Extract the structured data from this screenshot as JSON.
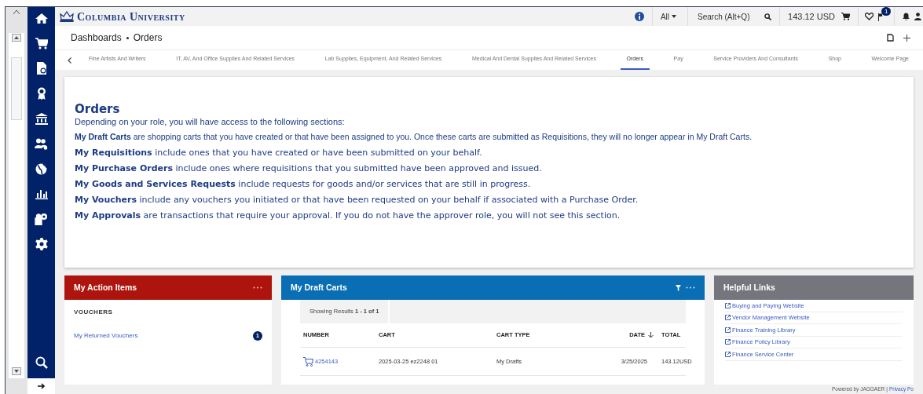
{
  "header": {
    "logo": "Columbia University",
    "scope": "All",
    "search_placeholder": "Search (Alt+Q)",
    "cart_total": "143.12 USD",
    "flag_count": "1"
  },
  "breadcrumb": [
    "Dashboards",
    "Orders"
  ],
  "tabs": [
    {
      "label": "Fine Artists And Writers",
      "selected": false
    },
    {
      "label": "IT, AV, And Office Supplies And Related Services",
      "selected": false
    },
    {
      "label": "Lab Supplies, Equipment, And Related Services",
      "selected": false
    },
    {
      "label": "Medical And Dental Supplies And Related Services",
      "selected": false
    },
    {
      "label": "Orders",
      "selected": true
    },
    {
      "label": "Pay",
      "selected": false
    },
    {
      "label": "Service Providers And Consultants",
      "selected": false
    },
    {
      "label": "Shop",
      "selected": false
    },
    {
      "label": "Welcome Page",
      "selected": false
    }
  ],
  "intro": {
    "title": "Orders",
    "subtitle": "Depending on your role, you will have access to the following sections:",
    "items": [
      "**My Draft Carts** are shopping carts that you have created or that have been assigned to you. Once these carts are submitted as Requisitions, they will no longer appear in My Draft Carts.",
      "**My Requisitions** include ones that you have created or have been submitted on your behalf.",
      "**My Purchase Orders** include ones where requisitions that you submitted have been approved and issued.",
      "**My Goods and Services Requests** include requests for goods and/or services that are still in progress.",
      "**My Vouchers** include any vouchers you initiated or that have been requested on your behalf if associated with a Purchase Order.",
      "**My Approvals** are transactions that require your approval. If you do not have the approver role, you will not see this section."
    ]
  },
  "action_items": {
    "title": "My Action Items",
    "section": "VOUCHERS",
    "items": [
      {
        "label": "My Returned Vouchers",
        "count": "1"
      }
    ]
  },
  "draft_carts": {
    "title": "My Draft Carts",
    "results": "Showing Results **1 - 1 of 1**",
    "columns": [
      {
        "label": "NUMBER",
        "sorted": false
      },
      {
        "label": "CART",
        "sorted": false
      },
      {
        "label": "CART TYPE",
        "sorted": false
      },
      {
        "label": "DATE",
        "sorted": true
      },
      {
        "label": "TOTAL",
        "sorted": false
      }
    ],
    "rows": [
      [
        "4254143",
        "2025-03-25 ez2248 01",
        "My Drafts",
        "3/25/2025",
        "143.12USD"
      ]
    ]
  },
  "helpful_links": {
    "title": "Helpful Links",
    "links": [
      "Buying and Paying Website",
      "Vendor Management Website",
      "Finance Training Library",
      "Finance Policy Library",
      "Finance Service Center"
    ]
  },
  "footer": {
    "powered": "Powered by JAGGAER",
    "separator": "|",
    "privacy": "Privacy Po"
  }
}
